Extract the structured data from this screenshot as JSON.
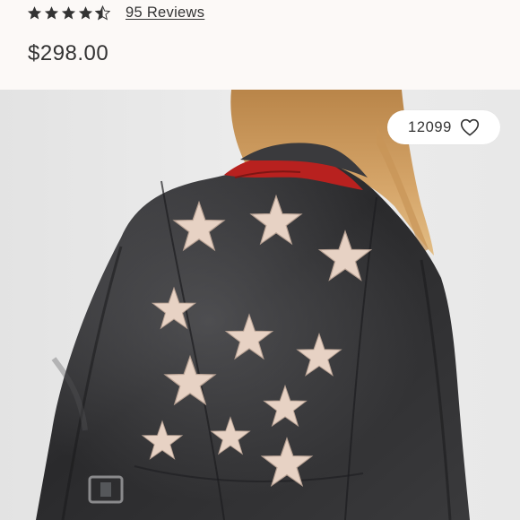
{
  "rating": {
    "value": 4.5,
    "max": 5,
    "reviews_text": "95 Reviews"
  },
  "price": "$298.00",
  "product_image": {
    "icon": "star-patch-leather-jacket-photo"
  },
  "like": {
    "count": "12099",
    "icon": "heart-icon"
  },
  "colors": {
    "header_bg": "#fcf9f7",
    "text": "#333333",
    "image_bg": "#ebebeb",
    "jacket": "#2e2e30",
    "star_patch": "#e7d2c4",
    "collar_red": "#b8211f"
  }
}
